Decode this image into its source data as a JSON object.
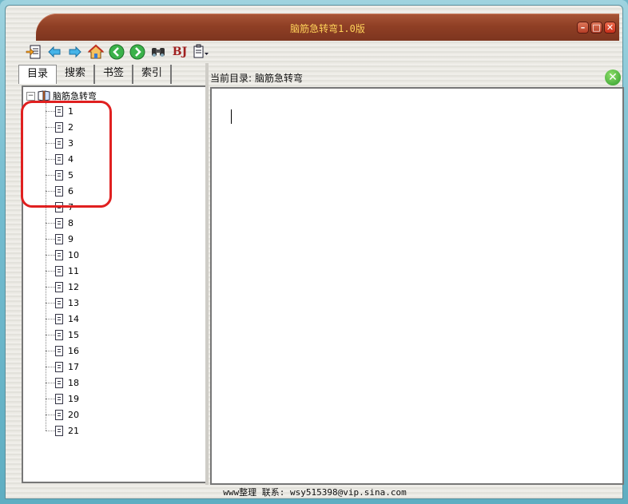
{
  "window": {
    "title": "脑筋急转弯1.0版"
  },
  "toolbar": {
    "bj_label": "BJ"
  },
  "tabs": [
    {
      "label": "目录"
    },
    {
      "label": "搜索"
    },
    {
      "label": "书签"
    },
    {
      "label": "索引"
    }
  ],
  "tree": {
    "root": "脑筋急转弯",
    "items": [
      "1",
      "2",
      "3",
      "4",
      "5",
      "6",
      "7",
      "8",
      "9",
      "10",
      "11",
      "12",
      "13",
      "14",
      "15",
      "16",
      "17",
      "18",
      "19",
      "20",
      "21"
    ]
  },
  "path": {
    "label": "当前目录:",
    "value": "脑筋急转弯"
  },
  "status": {
    "text": "www整理 联系: wsy515398@vip.sina.com"
  },
  "colors": {
    "titlebar": "#8f3f25",
    "title_text": "#ffd35a",
    "highlight": "#e02020"
  }
}
